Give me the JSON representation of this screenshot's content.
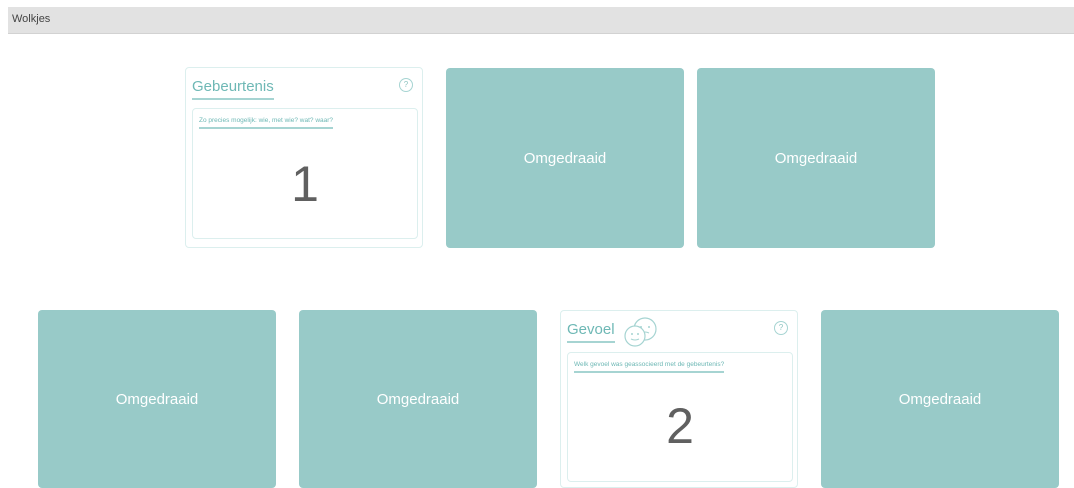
{
  "window": {
    "title": "Wolkjes"
  },
  "cards": {
    "gebeurtenis": {
      "title": "Gebeurtenis",
      "help": "?",
      "prompt": "Zo precies mogelijk: wie, met wie? wat? waar?",
      "number": "1"
    },
    "gevoel": {
      "title": "Gevoel",
      "help": "?",
      "prompt": "Welk gevoel was geassocieerd met de gebeurtenis?",
      "number": "2"
    },
    "flipped_label": "Omgedraaid",
    "flipped_cards": [
      {
        "label": "Omgedraaid"
      },
      {
        "label": "Omgedraaid"
      },
      {
        "label": "Omgedraaid"
      },
      {
        "label": "Omgedraaid"
      },
      {
        "label": "Omgedraaid"
      }
    ]
  },
  "colors": {
    "card_back": "#98cac8",
    "accent": "#6eb8b5",
    "topbar": "#e2e2e2"
  },
  "icons": {
    "gevoel_icon": "faces-icon"
  }
}
